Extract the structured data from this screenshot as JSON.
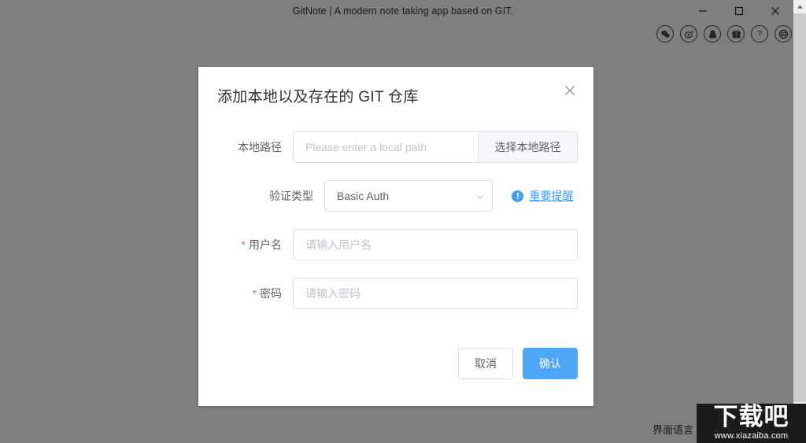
{
  "window": {
    "title": "GitNote | A modern note taking app based on GIT.",
    "controls": {
      "minimize": "minimize-icon",
      "maximize": "maximize-icon",
      "close": "close-icon"
    }
  },
  "social_icons": [
    {
      "name": "wechat-icon",
      "label": "WeChat"
    },
    {
      "name": "weibo-icon",
      "label": "Weibo"
    },
    {
      "name": "qq-icon",
      "label": "QQ"
    },
    {
      "name": "gift-icon",
      "label": "Gift"
    },
    {
      "name": "help-icon",
      "label": "?"
    },
    {
      "name": "globe-icon",
      "label": "Language"
    }
  ],
  "app": {
    "interface_language_label": "界面语言"
  },
  "dialog": {
    "title": "添加本地以及存在的 GIT 仓库",
    "close_label": "×",
    "fields": {
      "local_path": {
        "label": "本地路径",
        "value": "",
        "placeholder": "Please enter a local path",
        "button_label": "选择本地路径"
      },
      "auth_type": {
        "label": "验证类型",
        "selected": "Basic Auth",
        "options": [
          "Basic Auth"
        ],
        "hint_link": "重要提醒",
        "hint_icon": "info-icon"
      },
      "username": {
        "label": "用户名",
        "required": true,
        "required_mark": "*",
        "value": "",
        "placeholder": "请输入用户名"
      },
      "password": {
        "label": "密码",
        "required": true,
        "required_mark": "*",
        "value": "",
        "placeholder": "请输入密码"
      }
    },
    "footer": {
      "cancel_label": "取消",
      "confirm_label": "确认"
    }
  },
  "watermark": {
    "logo_text": "下载吧",
    "url_text": "www.xiazaiba.com"
  },
  "colors": {
    "primary": "#4ea6f7",
    "link": "#409eff",
    "required": "#f56c6c",
    "border": "#dcdfe6",
    "placeholder": "#c0c4cc",
    "label_text": "#606266",
    "title_text": "#303133",
    "backdrop": "#808080"
  }
}
